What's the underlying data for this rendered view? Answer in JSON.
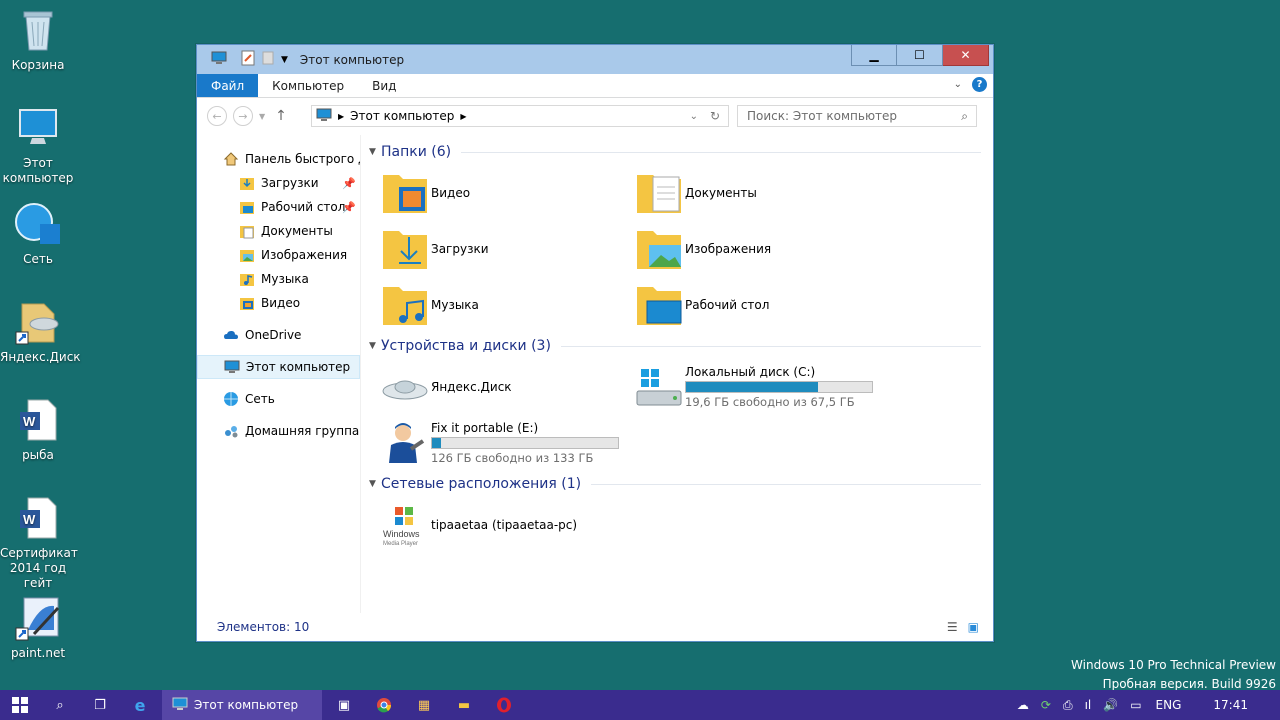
{
  "desktop": {
    "icons": [
      {
        "label": "Корзина"
      },
      {
        "label": "Этот компьютер"
      },
      {
        "label": "Сеть"
      },
      {
        "label": "Яндекс.Диск"
      },
      {
        "label": "рыба"
      },
      {
        "label": "Сертификат 2014 год гейт"
      },
      {
        "label": "paint.net"
      }
    ]
  },
  "window": {
    "title": "Этот компьютер",
    "ribbon": {
      "tabs": [
        "Файл",
        "Компьютер",
        "Вид"
      ]
    },
    "address": {
      "path": "Этот компьютер"
    },
    "search": {
      "placeholder": "Поиск: Этот компьютер"
    },
    "sidebar": {
      "items": [
        {
          "label": "Панель быстрого доступа",
          "icon": "home-icon"
        },
        {
          "label": "Загрузки",
          "icon": "downloads-icon"
        },
        {
          "label": "Рабочий стол",
          "icon": "desktop-icon"
        },
        {
          "label": "Документы",
          "icon": "documents-icon"
        },
        {
          "label": "Изображения",
          "icon": "pictures-icon"
        },
        {
          "label": "Музыка",
          "icon": "music-icon"
        },
        {
          "label": "Видео",
          "icon": "video-icon"
        },
        {
          "label": "OneDrive",
          "icon": "cloud-icon"
        },
        {
          "label": "Этот компьютер",
          "icon": "computer-icon"
        },
        {
          "label": "Сеть",
          "icon": "network-icon"
        },
        {
          "label": "Домашняя группа",
          "icon": "homegroup-icon"
        }
      ]
    },
    "groups": {
      "folders": {
        "header": "Папки (6)",
        "items": [
          "Видео",
          "Документы",
          "Загрузки",
          "Изображения",
          "Музыка",
          "Рабочий стол"
        ]
      },
      "devices": {
        "header": "Устройства и диски (3)",
        "yandex": {
          "label": "Яндекс.Диск"
        },
        "local": {
          "label": "Локальный диск (C:)",
          "free": "19,6 ГБ свободно из 67,5 ГБ",
          "used_fraction": 0.71
        },
        "fixit": {
          "label": "Fix it portable (E:)",
          "free": "126 ГБ свободно из 133 ГБ",
          "used_fraction": 0.05
        }
      },
      "network": {
        "header": "Сетевые расположения (1)",
        "items": [
          "tipaaetaa (tipaaetaa-pc)"
        ]
      }
    },
    "status": {
      "count": "Элементов: 10"
    }
  },
  "watermark": {
    "line1": "Windows 10 Pro Technical Preview",
    "line2": "Пробная версия. Build 9926"
  },
  "taskbar": {
    "active_task": "Этот компьютер",
    "lang": "ENG",
    "time": "17:41"
  }
}
